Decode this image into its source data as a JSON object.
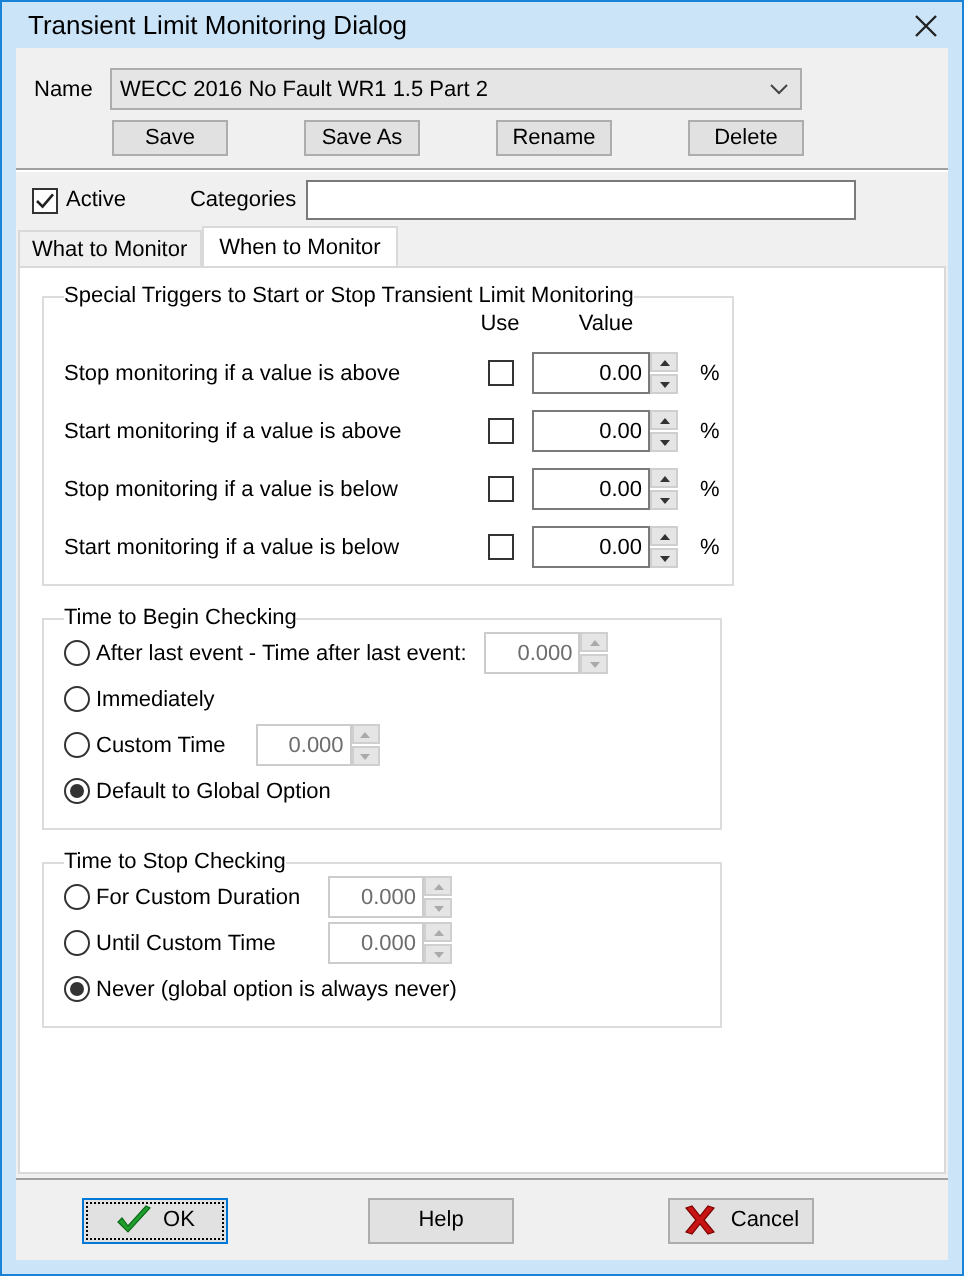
{
  "window": {
    "title": "Transient Limit Monitoring Dialog"
  },
  "name": {
    "label": "Name",
    "value": "WECC 2016 No Fault WR1 1.5 Part 2"
  },
  "name_buttons": [
    "Save",
    "Save As",
    "Rename",
    "Delete"
  ],
  "active": {
    "label": "Active",
    "checked": true
  },
  "categories": {
    "label": "Categories"
  },
  "tabs": [
    {
      "label": "What to Monitor",
      "selected": false
    },
    {
      "label": "When to Monitor",
      "selected": true
    }
  ],
  "triggers": {
    "title": "Special Triggers to Start or Stop Transient Limit Monitoring",
    "columns": [
      "Use",
      "Value"
    ],
    "rows": [
      {
        "label": "Stop monitoring if a value is above",
        "checked": false,
        "value": "0.00",
        "unit": "%"
      },
      {
        "label": "Start monitoring if a value is above",
        "checked": false,
        "value": "0.00",
        "unit": "%"
      },
      {
        "label": "Stop monitoring if a value is below",
        "checked": false,
        "value": "0.00",
        "unit": "%"
      },
      {
        "label": "Start monitoring if a value is below",
        "checked": false,
        "value": "0.00",
        "unit": "%"
      }
    ]
  },
  "begin_checking": {
    "title": "Time to Begin Checking",
    "options": [
      {
        "label": "After last event - Time after last event:",
        "selected": false,
        "value": "0.000",
        "disabled": true
      },
      {
        "label": "Immediately",
        "selected": false
      },
      {
        "label": "Custom Time",
        "selected": false,
        "value": "0.000",
        "disabled": true
      },
      {
        "label": "Default to Global Option",
        "selected": true
      }
    ]
  },
  "stop_checking": {
    "title": "Time to Stop Checking",
    "options": [
      {
        "label": "For Custom Duration",
        "selected": false,
        "value": "0.000",
        "disabled": true
      },
      {
        "label": "Until Custom Time",
        "selected": false,
        "value": "0.000",
        "disabled": true
      },
      {
        "label": "Never (global option is always never)",
        "selected": true
      }
    ]
  },
  "buttons": [
    {
      "label": "OK",
      "kind": "ok",
      "focused": true
    },
    {
      "label": "Help",
      "kind": "plain",
      "focused": false
    },
    {
      "label": "Cancel",
      "kind": "cancel",
      "focused": false
    }
  ]
}
